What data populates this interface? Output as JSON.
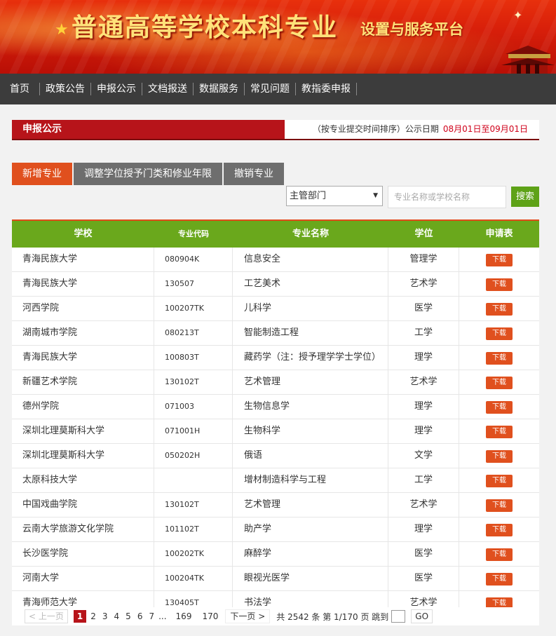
{
  "banner": {
    "title": "普通高等学校本科专业",
    "subtitle": "设置与服务平台"
  },
  "nav": {
    "items": [
      "首页",
      "政策公告",
      "申报公示",
      "文档报送",
      "数据服务",
      "常见问题",
      "教指委申报"
    ]
  },
  "section": {
    "title": "申报公示",
    "sort_note": "（按专业提交时间排序）公示日期",
    "date_range": "08月01日至09月01日"
  },
  "tabs": [
    "新增专业",
    "调整学位授予门类和修业年限",
    "撤销专业"
  ],
  "filters": {
    "dept_selected": "主管部门",
    "search_placeholder": "专业名称或学校名称",
    "search_button": "搜索"
  },
  "table": {
    "headers": [
      "学校",
      "专业代码",
      "专业名称",
      "学位",
      "申请表"
    ],
    "download_label": "下载",
    "rows": [
      {
        "school": "青海民族大学",
        "code": "080904K",
        "name": "信息安全",
        "degree": "管理学"
      },
      {
        "school": "青海民族大学",
        "code": "130507",
        "name": "工艺美术",
        "degree": "艺术学"
      },
      {
        "school": "河西学院",
        "code": "100207TK",
        "name": "儿科学",
        "degree": "医学"
      },
      {
        "school": "湖南城市学院",
        "code": "080213T",
        "name": "智能制造工程",
        "degree": "工学"
      },
      {
        "school": "青海民族大学",
        "code": "100803T",
        "name": "藏药学（注：授予理学学士学位）",
        "degree": "理学"
      },
      {
        "school": "新疆艺术学院",
        "code": "130102T",
        "name": "艺术管理",
        "degree": "艺术学"
      },
      {
        "school": "德州学院",
        "code": "071003",
        "name": "生物信息学",
        "degree": "理学"
      },
      {
        "school": "深圳北理莫斯科大学",
        "code": "071001H",
        "name": "生物科学",
        "degree": "理学"
      },
      {
        "school": "深圳北理莫斯科大学",
        "code": "050202H",
        "name": "俄语",
        "degree": "文学"
      },
      {
        "school": "太原科技大学",
        "code": "",
        "name": "增材制造科学与工程",
        "degree": "工学"
      },
      {
        "school": "中国戏曲学院",
        "code": "130102T",
        "name": "艺术管理",
        "degree": "艺术学"
      },
      {
        "school": "云南大学旅游文化学院",
        "code": "101102T",
        "name": "助产学",
        "degree": "理学"
      },
      {
        "school": "长沙医学院",
        "code": "100202TK",
        "name": "麻醉学",
        "degree": "医学"
      },
      {
        "school": "河南大学",
        "code": "100204TK",
        "name": "眼视光医学",
        "degree": "医学"
      },
      {
        "school": "青海师范大学",
        "code": "130405T",
        "name": "书法学",
        "degree": "艺术学"
      }
    ]
  },
  "pager": {
    "prev": "上一页",
    "pages": [
      "1",
      "2",
      "3",
      "4",
      "5",
      "6",
      "7"
    ],
    "ellipsis": "...",
    "tail_pages": [
      "169",
      "170"
    ],
    "current": "1",
    "next": "下一页",
    "info": "共 2542 条 第 1/170 页 跳到",
    "go": "GO"
  }
}
